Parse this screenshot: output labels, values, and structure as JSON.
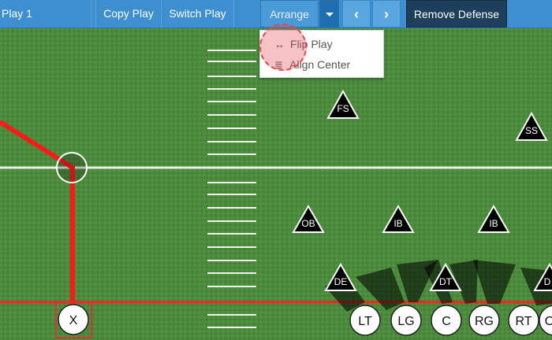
{
  "toolbar": {
    "play_name": "Play 1",
    "copy_play": "Copy Play",
    "switch_play": "Switch Play",
    "arrange": "Arrange",
    "prev_icon": "chevron-left-icon",
    "next_icon": "chevron-right-icon",
    "prev_glyph": "‹",
    "next_glyph": "›",
    "remove_defense": "Remove Defense"
  },
  "arrange_menu": {
    "items": [
      {
        "label": "Flip Play",
        "icon": "arrows-horizontal-icon",
        "glyph": "↔"
      },
      {
        "label": "Align Center",
        "icon": "list-lines-icon",
        "glyph": "≣"
      }
    ]
  },
  "defense": [
    {
      "label": "FS"
    },
    {
      "label": "SS"
    },
    {
      "label": "OB"
    },
    {
      "label": "IB"
    },
    {
      "label": "IB"
    },
    {
      "label": "DE"
    },
    {
      "label": "DT"
    },
    {
      "label": "D"
    }
  ],
  "offense": [
    {
      "label": "X"
    },
    {
      "label": "LT"
    },
    {
      "label": "LG"
    },
    {
      "label": "C"
    },
    {
      "label": "RG"
    },
    {
      "label": "RT"
    },
    {
      "label": "O"
    }
  ],
  "colors": {
    "toolbar": "#3d8fd0",
    "field": "#4a8a3a",
    "route": "#ff1a1a",
    "line_of_scrimmage": "#ff2222",
    "dark_button": "#1e3f5c"
  }
}
